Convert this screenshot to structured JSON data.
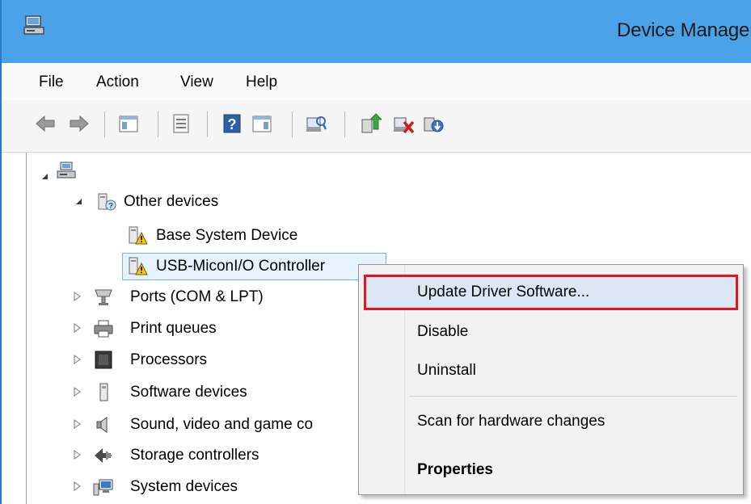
{
  "window": {
    "title": "Device Manager"
  },
  "menubar": {
    "items": [
      "File",
      "Action",
      "View",
      "Help"
    ]
  },
  "toolbar": {
    "buttons": [
      "back-icon",
      "forward-icon",
      "show-hide-console-tree-icon",
      "properties-icon",
      "help-icon",
      "action-pane-icon",
      "scan-hardware-icon",
      "update-driver-icon",
      "uninstall-device-icon",
      "enable-device-icon"
    ]
  },
  "tree": {
    "root_icon": "computer-icon",
    "items": [
      {
        "label": "Other devices",
        "icon": "unknown-device-icon",
        "expanded": true
      },
      {
        "label": "Base System Device",
        "icon": "warning-device-icon"
      },
      {
        "label": "USB-MiconI/O Controller",
        "icon": "warning-device-icon",
        "selected": true
      },
      {
        "label": "Ports (COM & LPT)",
        "icon": "port-icon"
      },
      {
        "label": "Print queues",
        "icon": "printer-icon"
      },
      {
        "label": "Processors",
        "icon": "processor-icon"
      },
      {
        "label": "Software devices",
        "icon": "software-device-icon"
      },
      {
        "label": "Sound, video and game co",
        "icon": "speaker-icon"
      },
      {
        "label": "Storage controllers",
        "icon": "storage-controller-icon"
      },
      {
        "label": "System devices",
        "icon": "system-device-icon"
      }
    ]
  },
  "context_menu": {
    "items": [
      {
        "label": "Update Driver Software...",
        "highlighted": true
      },
      {
        "label": "Disable"
      },
      {
        "label": "Uninstall"
      },
      {
        "label": "Scan for hardware changes"
      },
      {
        "label": "Properties",
        "bold": true
      }
    ]
  },
  "colors": {
    "titlebar": "#4aa3e8",
    "highlight_border": "#e8131c",
    "selection": "#e6f2fc"
  }
}
